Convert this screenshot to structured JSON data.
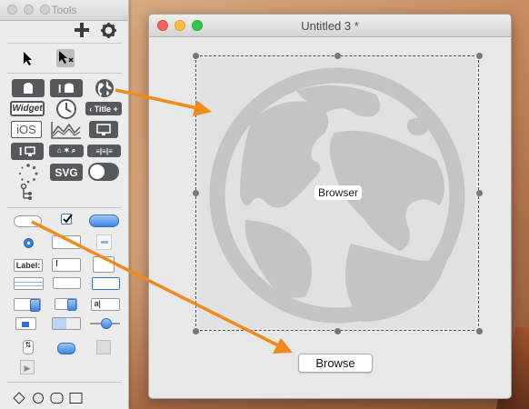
{
  "tools_window": {
    "title": "Tools",
    "add_icon": "plus-icon",
    "settings_icon": "gear-icon",
    "palette": {
      "widget_label": "Widget",
      "title_label": "Title",
      "ios_label": "iOS",
      "svg_label": "SVG",
      "label_label": "Label:"
    }
  },
  "document_window": {
    "title": "Untitled 3 *",
    "webview_label": "Browser",
    "button_label": "Browse"
  },
  "colors": {
    "arrow": "#f08a1c",
    "globe": "#c4c4c4",
    "close": "#fc605c",
    "minimize": "#fdbc40",
    "zoom": "#34c84a"
  }
}
